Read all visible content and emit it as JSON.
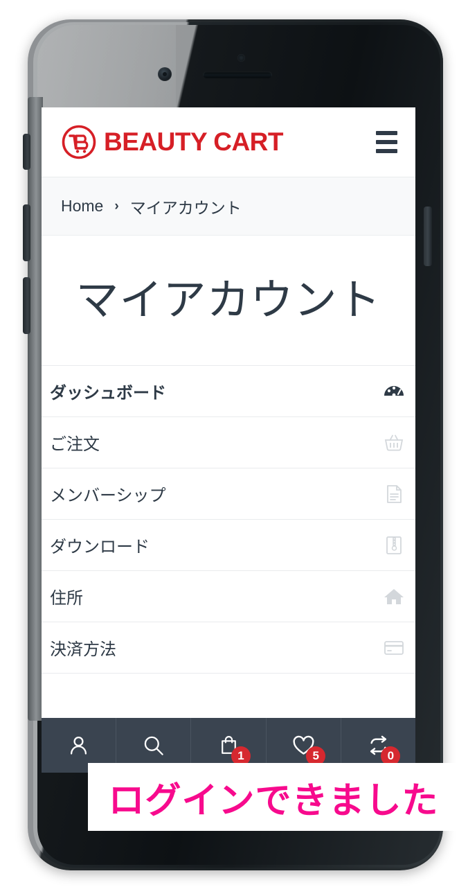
{
  "device": {
    "type": "smartphone-mockup",
    "buttons": [
      "mute-switch",
      "volume-up",
      "volume-down",
      "power"
    ],
    "features": [
      "front-camera",
      "proximity-sensor",
      "earpiece-speaker"
    ]
  },
  "header": {
    "brand_name": "BEAUTY CART",
    "brand_color": "#d61f26",
    "logo_icon": "shopping-cart-b-circle-logo",
    "menu_icon": "hamburger-menu-icon"
  },
  "breadcrumb": {
    "home_label": "Home",
    "separator": "›",
    "current_label": "マイアカウント"
  },
  "page": {
    "title": "マイアカウント"
  },
  "account_menu": {
    "items": [
      {
        "label": "ダッシュボード",
        "icon": "dashboard-gauge-icon",
        "active": true
      },
      {
        "label": "ご注文",
        "icon": "shopping-basket-icon",
        "active": false
      },
      {
        "label": "メンバーシップ",
        "icon": "document-lines-icon",
        "active": false
      },
      {
        "label": "ダウンロード",
        "icon": "download-zip-icon",
        "active": false
      },
      {
        "label": "住所",
        "icon": "home-icon",
        "active": false
      },
      {
        "label": "決済方法",
        "icon": "credit-card-icon",
        "active": false
      }
    ]
  },
  "bottom_nav": {
    "background_color": "#3a4450",
    "badge_color": "#d6282f",
    "items": [
      {
        "icon": "user-account-icon",
        "badge": null
      },
      {
        "icon": "search-icon",
        "badge": null
      },
      {
        "icon": "shopping-bag-icon",
        "badge": "1"
      },
      {
        "icon": "heart-wishlist-icon",
        "badge": "5"
      },
      {
        "icon": "compare-arrows-icon",
        "badge": "0"
      }
    ]
  },
  "overlay": {
    "caption": "ログインできました",
    "text_color": "#f70a8d",
    "background_color": "#ffffff"
  }
}
